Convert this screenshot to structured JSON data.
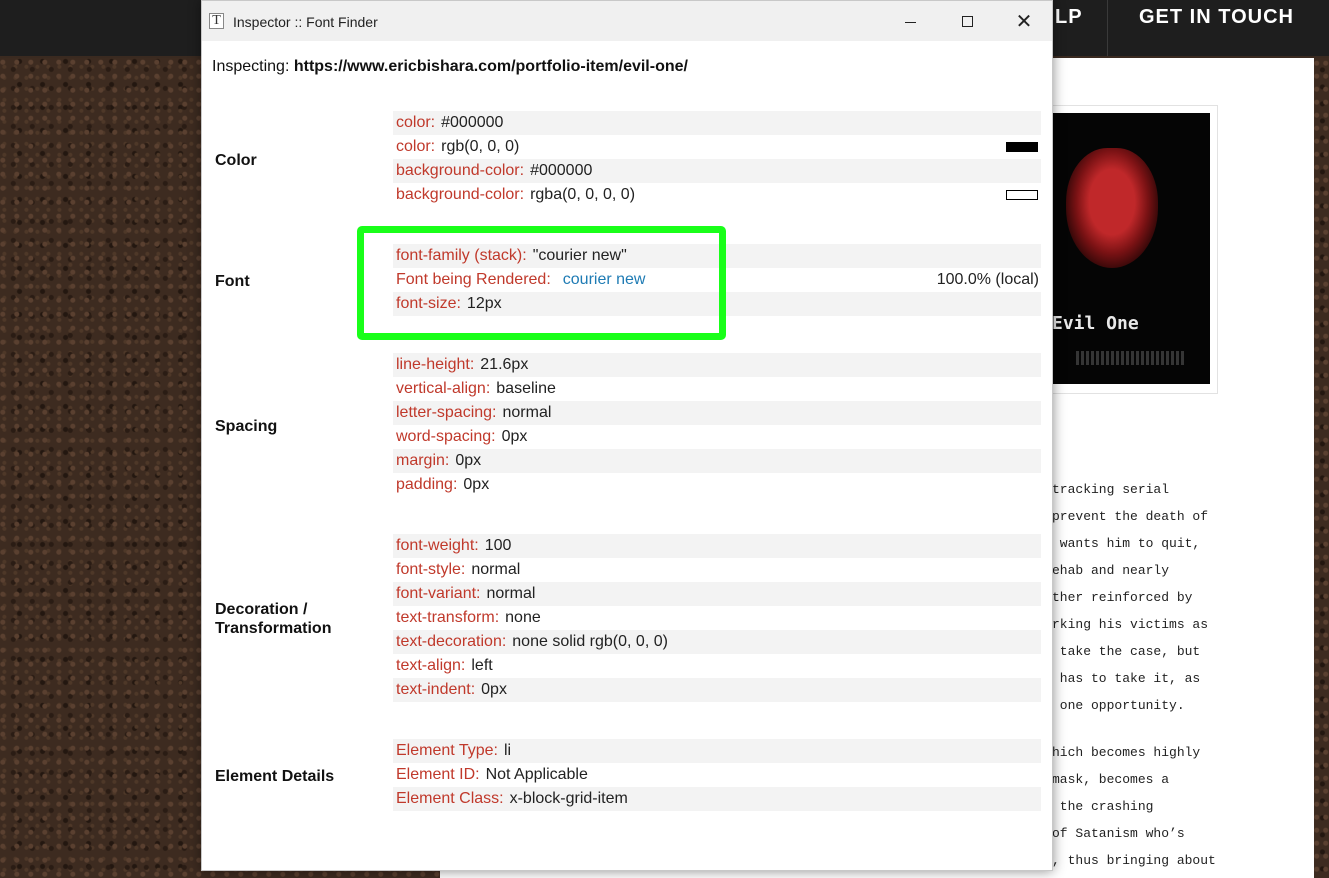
{
  "site": {
    "nav": [
      "LP",
      "GET IN TOUCH"
    ],
    "poster_title": "Evil One",
    "story_p1": [
      "tracking serial",
      "prevent the death of",
      " wants him to quit,",
      "ehab and nearly",
      "ther reinforced by",
      "rking his victims as",
      " take the case, but",
      " has to take it, as",
      " one opportunity."
    ],
    "story_p2": [
      "hich becomes highly",
      "mask, becomes a",
      " the crashing",
      "of Satanism who’s",
      ", thus bringing about"
    ]
  },
  "window": {
    "title": "Inspector :: Font Finder",
    "icon_glyph": "T",
    "close_glyph": "✕"
  },
  "inspecting": {
    "label": "Inspecting:",
    "url": "https://www.ericbishara.com/portfolio-item/evil-one/"
  },
  "sections": {
    "color": {
      "label": "Color",
      "rows": [
        {
          "k": "color:",
          "v": "#000000"
        },
        {
          "k": "color:",
          "v": "rgb(0, 0, 0)",
          "swatch": "#000000"
        },
        {
          "k": "background-color:",
          "v": "#000000"
        },
        {
          "k": "background-color:",
          "v": "rgba(0, 0, 0, 0)",
          "swatch": "transparent"
        }
      ]
    },
    "font": {
      "label": "Font",
      "rows": [
        {
          "k": "font-family (stack):",
          "v": "\"courier new\""
        },
        {
          "k": "Font being Rendered:",
          "v": "courier new",
          "right": "100.0% (local)"
        },
        {
          "k": "font-size:",
          "v": "12px"
        }
      ]
    },
    "spacing": {
      "label": "Spacing",
      "rows": [
        {
          "k": "line-height:",
          "v": "21.6px"
        },
        {
          "k": "vertical-align:",
          "v": "baseline"
        },
        {
          "k": "letter-spacing:",
          "v": "normal"
        },
        {
          "k": "word-spacing:",
          "v": "0px"
        },
        {
          "k": "margin:",
          "v": "0px"
        },
        {
          "k": "padding:",
          "v": "0px"
        }
      ]
    },
    "decoration": {
      "label_line1": "Decoration /",
      "label_line2": "Transformation",
      "rows": [
        {
          "k": "font-weight:",
          "v": "100"
        },
        {
          "k": "font-style:",
          "v": "normal"
        },
        {
          "k": "font-variant:",
          "v": "normal"
        },
        {
          "k": "text-transform:",
          "v": "none"
        },
        {
          "k": "text-decoration:",
          "v": "none solid rgb(0, 0, 0)"
        },
        {
          "k": "text-align:",
          "v": "left"
        },
        {
          "k": "text-indent:",
          "v": "0px"
        }
      ]
    },
    "element": {
      "label": "Element Details",
      "rows": [
        {
          "k": "Element Type:",
          "v": "li"
        },
        {
          "k": "Element ID:",
          "v": "Not Applicable"
        },
        {
          "k": "Element Class:",
          "v": "x-block-grid-item"
        }
      ]
    }
  },
  "colors": {
    "key": "#c0392b",
    "link": "#1e7bb4",
    "highlight": "#19ff19",
    "row_shade": "#f3f3f3"
  }
}
